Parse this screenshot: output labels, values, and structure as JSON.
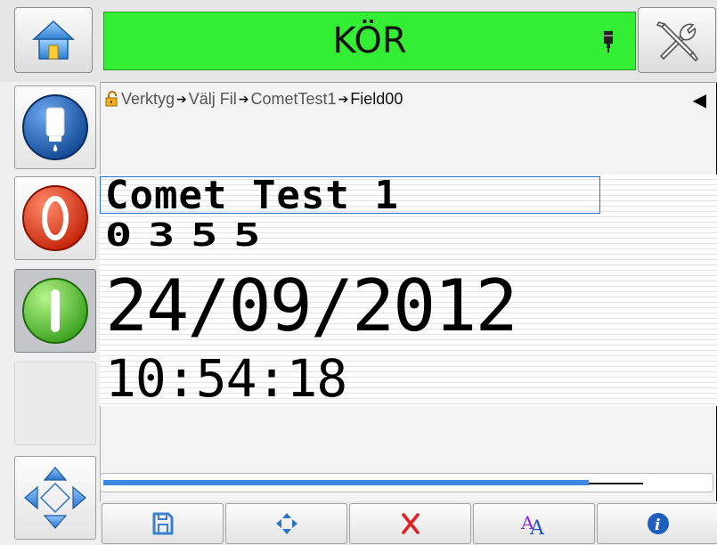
{
  "header": {
    "status_text": "KÖR",
    "status_color": "#33ee33",
    "home_icon": "home-icon",
    "tools_icon": "tools-icon",
    "ink_icon": "ink-level-icon"
  },
  "sidebar": {
    "items": [
      {
        "icon": "ink-bottle-icon"
      },
      {
        "icon": "stop-icon"
      },
      {
        "icon": "start-icon",
        "pressed": true
      },
      {
        "icon": ""
      },
      {
        "icon": "navigate-arrows-icon"
      }
    ]
  },
  "breadcrumb": {
    "lock_icon": "lock-icon",
    "items": [
      "Verktyg",
      "Välj Fil",
      "CometTest1",
      "Field00"
    ],
    "back_icon": "back-arrow-icon"
  },
  "print_preview": {
    "lines": [
      "Comet Test 1",
      "0355",
      "24/09/2012",
      "10:54:18"
    ]
  },
  "progress": {
    "fill_fraction": 0.8
  },
  "toolbar": {
    "buttons": [
      {
        "icon": "save-icon"
      },
      {
        "icon": "move-icon"
      },
      {
        "icon": "delete-icon"
      },
      {
        "icon": "font-icon"
      },
      {
        "icon": "info-icon"
      }
    ]
  }
}
